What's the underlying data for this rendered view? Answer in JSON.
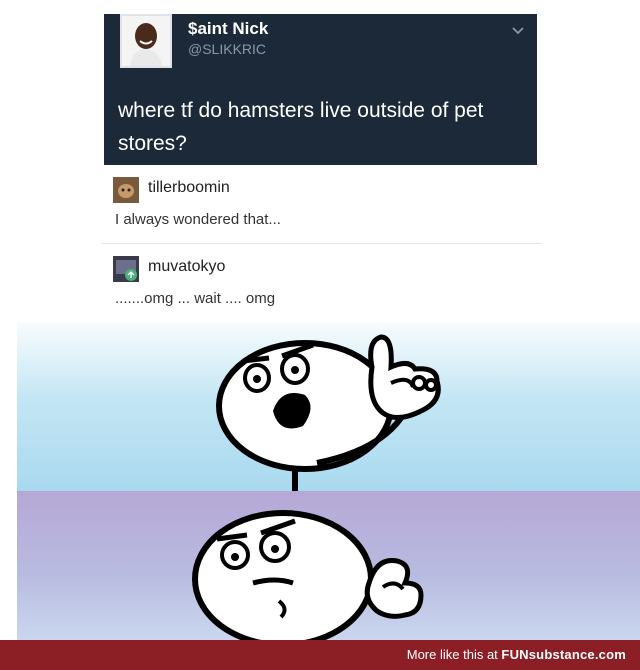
{
  "tweet": {
    "display_name": "$aint Nick",
    "handle": "@SLIKKRIC",
    "text": "where tf do hamsters live outside of pet stores?",
    "menu_icon": "chevron-down-icon"
  },
  "replies": [
    {
      "username": "tillerboomin",
      "text": "I always wondered that..."
    },
    {
      "username": "muvatokyo",
      "text": ".......omg ... wait .... omg"
    }
  ],
  "colors": {
    "tweet_bg": "#1c2938",
    "handle": "#8899a6",
    "footer_bg": "#8c1f25",
    "panel_top": "#a9d9ef",
    "panel_bottom": "#b6a8d6"
  },
  "footer": {
    "prefix": "More like this at",
    "brand_bold": "FUN",
    "brand_rest": "substance.com"
  }
}
